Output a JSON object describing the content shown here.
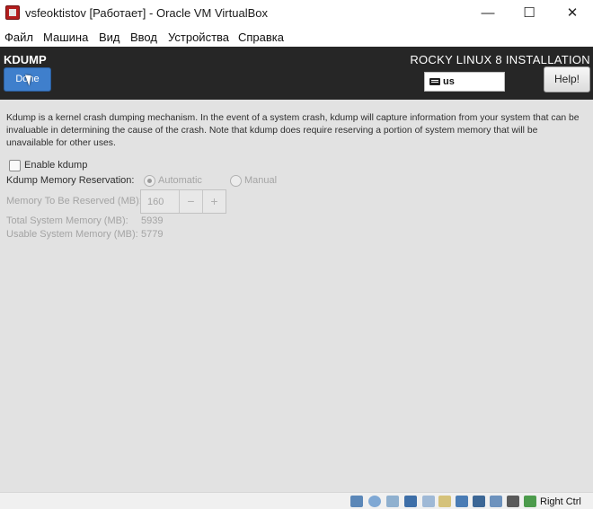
{
  "window": {
    "title": "vsfeoktistov [Работает] - Oracle VM VirtualBox",
    "minimize_glyph": "—",
    "maximize_glyph": "☐",
    "close_glyph": "✕"
  },
  "menu": {
    "items": [
      "Файл",
      "Машина",
      "Вид",
      "Ввод",
      "Устройства",
      "Справка"
    ]
  },
  "header": {
    "page_title": "KDUMP",
    "done_label": "Done",
    "install_title": "ROCKY LINUX 8 INSTALLATION",
    "keyboard_layout": "us",
    "help_label": "Help!"
  },
  "kdump": {
    "description": "Kdump is a kernel crash dumping mechanism. In the event of a system crash, kdump will capture information from your system that can be invaluable in determining the cause of the crash. Note that kdump does require reserving a portion of system memory that will be unavailable for other uses.",
    "enable_label": "Enable kdump",
    "enabled": false,
    "reservation_label": "Kdump Memory Reservation:",
    "reservation_options": [
      "Automatic",
      "Manual"
    ],
    "reservation_selected": "Automatic",
    "memory_label": "Memory To Be Reserved (MB):",
    "memory_value": "160",
    "minus": "−",
    "plus": "+",
    "total_label": "Total System Memory (MB):",
    "total_value": "5939",
    "usable_label": "Usable System Memory (MB):",
    "usable_value": "5779"
  },
  "statusbar": {
    "icons": [
      "hard-disk-icon",
      "optical-drive-icon",
      "audio-icon",
      "network-icon",
      "usb-icon",
      "shared-folders-icon",
      "display-icon",
      "video-capture-icon",
      "virtualization-icon",
      "cpu-icon",
      "mouse-integration-icon",
      "host-key-arrow-icon"
    ],
    "host_key": "Right Ctrl"
  },
  "colors": {
    "header_bg": "#262626",
    "done_button": "#3f7fcc",
    "content_bg": "#e2e2e2",
    "disabled_text": "#a4a4a4"
  }
}
